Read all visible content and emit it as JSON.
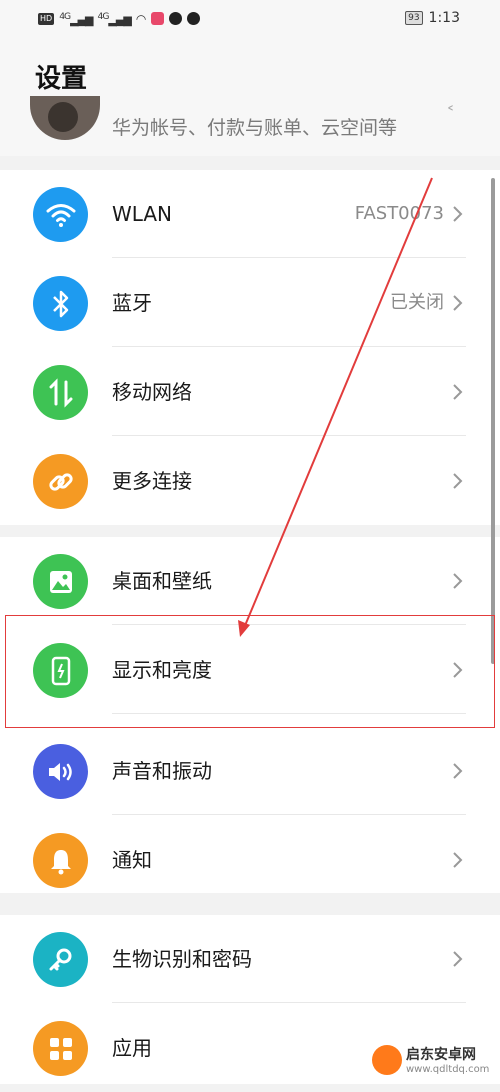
{
  "status_bar": {
    "net_hd": "HD",
    "net_4g_1": "4G",
    "net_4g_2": "4G",
    "battery": "93",
    "time": "1:13"
  },
  "header": {
    "title": "设置",
    "account_subtitle": "华为帐号、付款与账单、云空间等"
  },
  "groups": [
    {
      "items": [
        {
          "label": "WLAN",
          "value": "FAST0073",
          "icon": "wifi-icon",
          "color": "#1e9bf0"
        },
        {
          "label": "蓝牙",
          "value": "已关闭",
          "icon": "bluetooth-icon",
          "color": "#1e9bf0"
        },
        {
          "label": "移动网络",
          "value": "",
          "icon": "mobile-data-icon",
          "color": "#3ec354"
        },
        {
          "label": "更多连接",
          "value": "",
          "icon": "link-icon",
          "color": "#f59a23"
        }
      ]
    },
    {
      "items": [
        {
          "label": "桌面和壁纸",
          "value": "",
          "icon": "wallpaper-icon",
          "color": "#3ec354"
        },
        {
          "label": "显示和亮度",
          "value": "",
          "icon": "display-brightness-icon",
          "color": "#3ec354"
        },
        {
          "label": "声音和振动",
          "value": "",
          "icon": "speaker-icon",
          "color": "#4a5fe0"
        },
        {
          "label": "通知",
          "value": "",
          "icon": "bell-icon",
          "color": "#f59a23"
        }
      ]
    },
    {
      "items": [
        {
          "label": "生物识别和密码",
          "value": "",
          "icon": "key-icon",
          "color": "#1bb3c4"
        },
        {
          "label": "应用",
          "value": "",
          "icon": "apps-icon",
          "color": "#f59a23"
        }
      ]
    }
  ],
  "watermark": {
    "brand": "启东安卓网",
    "url": "www.qdltdq.com"
  }
}
